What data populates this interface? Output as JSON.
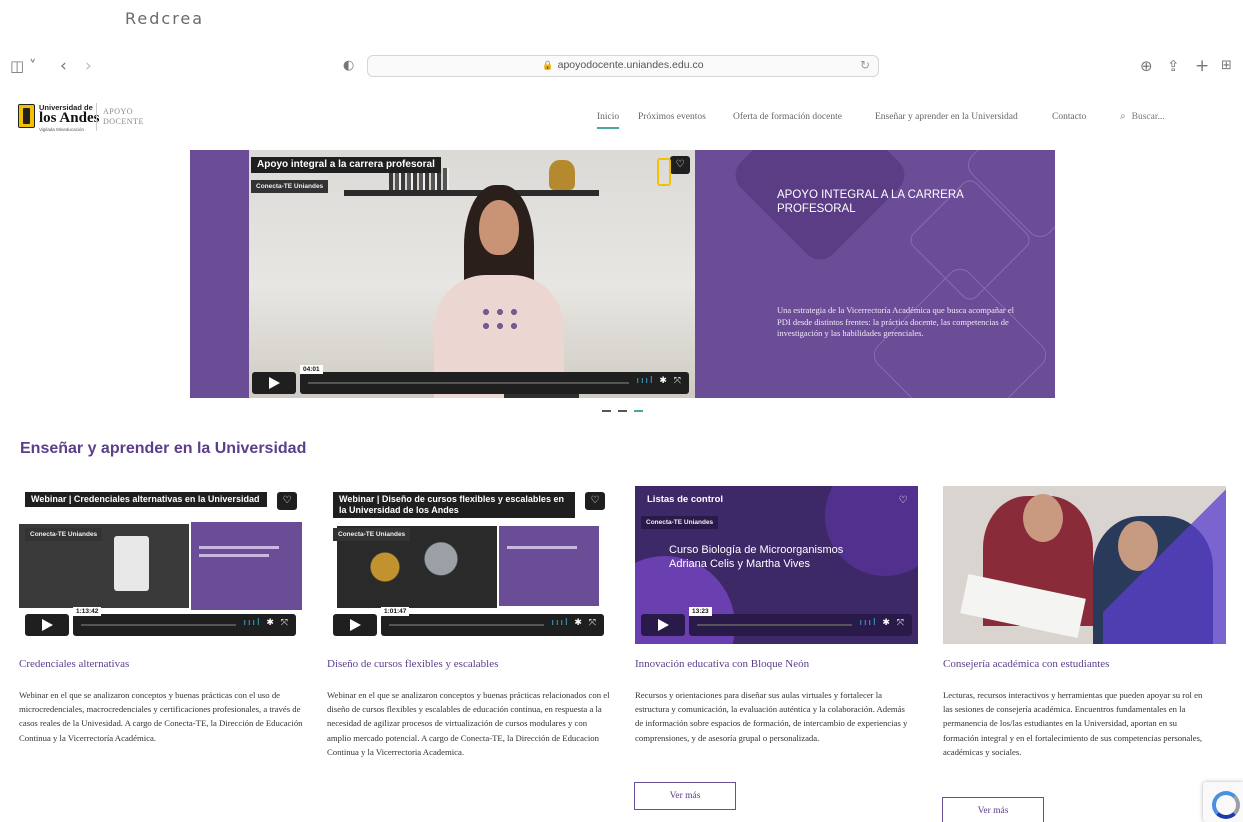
{
  "caption": "Redcrea",
  "browser": {
    "url": "apoyodocente.uniandes.edu.co",
    "icons": {
      "sidebar": "sidebar-icon",
      "back": "chevron-left-icon",
      "forward": "chevron-right-icon",
      "shield": "privacy-shield-icon",
      "reload": "reload-icon",
      "download": "download-icon",
      "share": "share-icon",
      "newtab": "plus-icon",
      "tabs": "tab-grid-icon"
    }
  },
  "logo": {
    "line1": "Universidad de",
    "line2": "los Andes",
    "line3": "Vigilada Mineducación",
    "line4": "APOYO",
    "line5": "DOCENTE"
  },
  "nav": {
    "items": [
      "Inicio",
      "Próximos eventos",
      "Oferta de formación docente",
      "Enseñar y aprender en la Universidad",
      "Contacto"
    ],
    "search_label": "Buscar..."
  },
  "hero": {
    "video_title": "Apoyo integral a la carrera profesoral",
    "channel": "Conecta-TE Uniandes",
    "duration": "04:01",
    "heading": "APOYO INTEGRAL A LA CARRERA PROFESORAL",
    "body": "Una estrategia de la Vicerrectoría Académica que busca acompañar el PDI desde distintos frentes: la práctica docente, las competencias de investigación y las habilidades gerenciales."
  },
  "section": {
    "title": "Enseñar y aprender en la Universidad"
  },
  "cards": [
    {
      "video_title": "Webinar | Credenciales alternativas en la Universidad",
      "channel": "Conecta-TE Uniandes",
      "duration": "1:13:42",
      "title": "Credenciales alternativas",
      "body": "Webinar en el que se analizaron conceptos y buenas prácticas con el uso de microcredenciales, macrocredenciales y certificaciones profesionales, a través de casos reales de la Univesidad. A cargo de Conecta-TE, la Dirección de Educación Continua y la Vicerrectoría Académica."
    },
    {
      "video_title": "Webinar | Diseño de cursos flexibles y escalables en la Universidad de los Andes",
      "channel": "Conecta-TE Uniandes",
      "duration": "1:01:47",
      "title": "Diseño de cursos flexibles y escalables",
      "body": "Webinar en el que se analizaron conceptos y buenas prácticas relacionados con el diseño de cursos flexibles y escalables de educación continua, en respuesta a la necesidad de agilizar procesos de virtualización de cursos modulares y con amplio mercado potencial. A cargo de Conecta-TE, la Dirección de Educacion Continua y la Vicerrectoria Academica."
    },
    {
      "video_title": "Listas de control",
      "channel": "Conecta-TE Uniandes",
      "overlay": "Curso Biología de Microorganismos Adriana Celis y Martha Vives",
      "duration": "13:23",
      "title": "Innovación educativa con Bloque Neón",
      "body": "Recursos y orientaciones para diseñar sus aulas virtuales y fortalecer la estructura y comunicación, la evaluación auténtica y la colaboración. Además de información sobre espacios de formación, de intercambio de experiencias y comprensiones, y de asesoría grupal o personalizada.",
      "button": "Ver más"
    },
    {
      "title": "Consejería académica con estudiantes",
      "body": "Lecturas, recursos interactivos y herramientas que pueden apoyar su rol en las sesiones de consejería académica. Encuentros fundamentales en la permanencia de los/las estudiantes en la Universidad, aportan en su formación integral y en el fortalecimiento de sus competencias personales, académicas y sociales.",
      "button": "Ver más"
    }
  ],
  "colors": {
    "brand": "#6b4c96",
    "accent": "#4aa7a0",
    "link": "#5b3f8a"
  }
}
